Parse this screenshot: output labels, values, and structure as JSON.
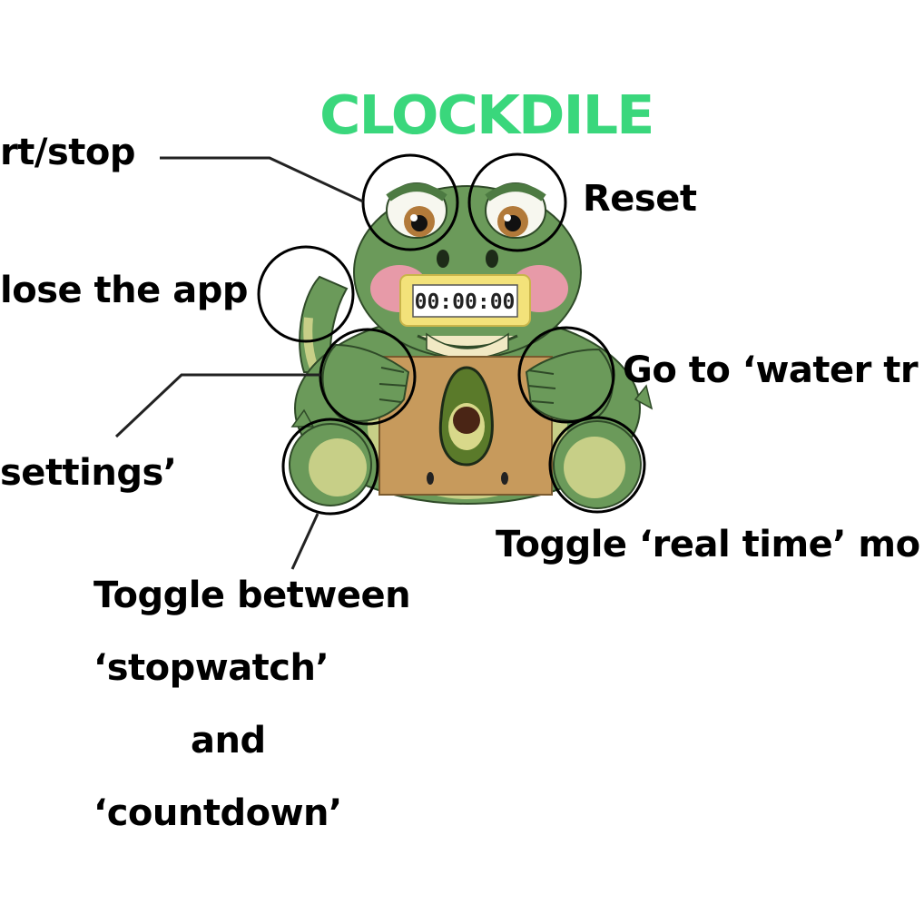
{
  "title": "CLOCKDILE",
  "display": {
    "time": "00:00:00"
  },
  "labels": {
    "start_stop": "rt/stop",
    "reset": "Reset",
    "close_app": "lose the app",
    "water_tracker": "Go to ‘water tr",
    "settings": "settings’",
    "real_time": "Toggle ‘real time’ mo",
    "toggle_line1": "Toggle between",
    "toggle_line2": "‘stopwatch’",
    "toggle_line3": "and",
    "toggle_line4": "‘countdown’"
  },
  "colors": {
    "title": "#3ad77c",
    "croc_body": "#6b9a5a",
    "croc_dark": "#4d7a42",
    "croc_light": "#c7cf87",
    "box": "#c79a5c",
    "display_frame": "#f3e27a"
  }
}
